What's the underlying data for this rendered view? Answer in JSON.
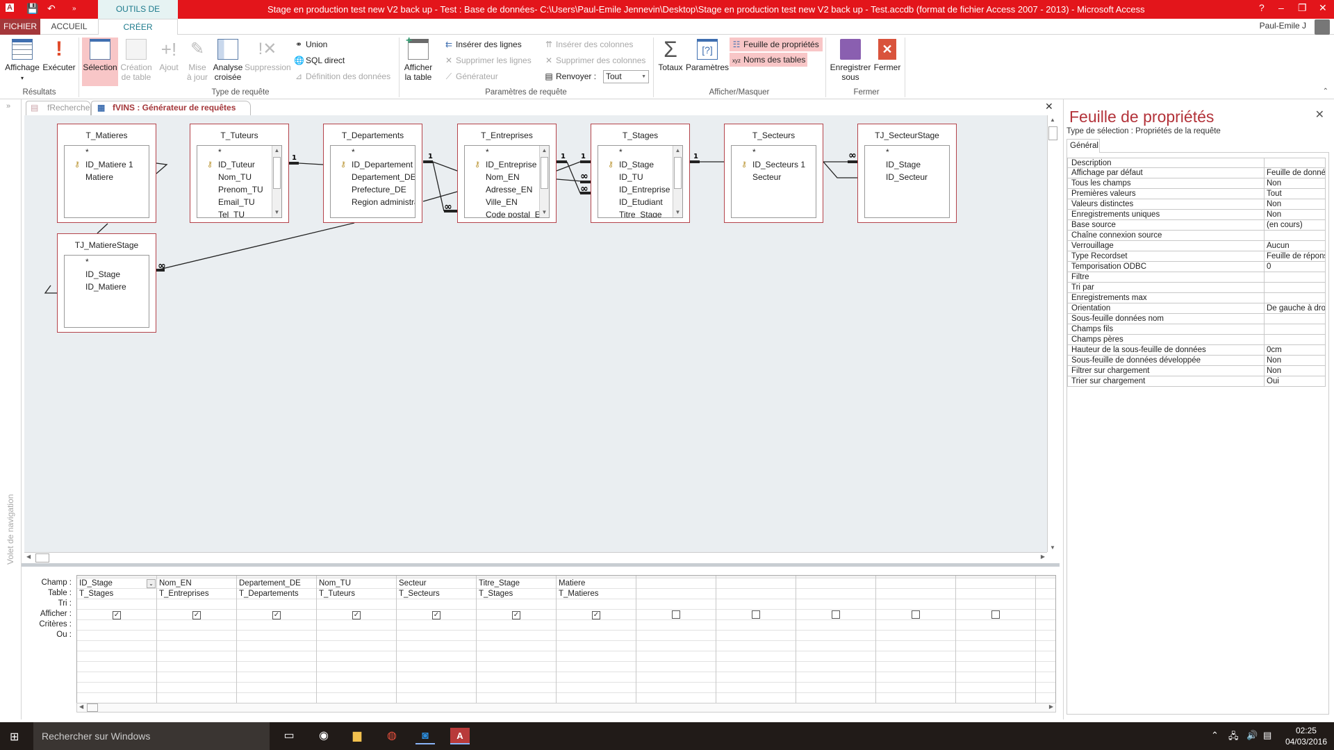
{
  "window": {
    "title": "Stage en production test new V2 back up - Test : Base de données- C:\\Users\\Paul-Emile Jennevin\\Desktop\\Stage en production test new V2 back up - Test.accdb (format de fichier Access 2007 - 2013) -  Microsoft Access",
    "context_tab": "OUTILS DE REQUÊTE",
    "user": "Paul-Emile J",
    "help": "?",
    "brand_color": "#e3151b"
  },
  "ribbon": {
    "tabs": [
      "FICHIER",
      "ACCUEIL",
      "CRÉER"
    ],
    "resultats": {
      "label": "Résultats",
      "affichage": "Affichage",
      "executer": "Exécuter"
    },
    "type_requete": {
      "label": "Type de requête",
      "selection": "Sélection",
      "creation": "Création",
      "creation2": "de table",
      "ajout": "Ajout",
      "mise": "Mise",
      "mise2": "à jour",
      "analyse": "Analyse",
      "analyse2": "croisée",
      "suppression": "Suppression",
      "union": "Union",
      "sql": "SQL direct",
      "definition": "Définition des données"
    },
    "parametres": {
      "label": "Paramètres de requête",
      "afficher": "Afficher",
      "afficher2": "la table",
      "inserer_lignes": "Insérer des lignes",
      "supprimer_lignes": "Supprimer les lignes",
      "generateur": "Générateur",
      "inserer_colonnes": "Insérer des colonnes",
      "supprimer_colonnes": "Supprimer des colonnes",
      "renvoyer": "Renvoyer :",
      "renvoyer_value": "Tout"
    },
    "afficher_masquer": {
      "label": "Afficher/Masquer",
      "totaux": "Totaux",
      "parametres": "Paramètres",
      "feuille": "Feuille de propriétés",
      "noms": "Noms des tables"
    },
    "fermer": {
      "label": "Fermer",
      "enregistrer": "Enregistrer",
      "enregistrer2": "sous",
      "fermer": "Fermer"
    }
  },
  "doc_tabs": [
    {
      "label": "fRecherche",
      "active": false
    },
    {
      "label": "fVINS : Générateur de requêtes",
      "active": true
    }
  ],
  "nav_pane": "Volet de navigation",
  "tables": [
    {
      "name": "T_Matieres",
      "fields": [
        "*",
        "ID_Matiere 1",
        "Matiere"
      ],
      "key": 1,
      "scroll": false
    },
    {
      "name": "T_Tuteurs",
      "fields": [
        "*",
        "ID_Tuteur",
        "Nom_TU",
        "Prenom_TU",
        "Email_TU",
        "Tel_TU"
      ],
      "key": 1,
      "scroll": true
    },
    {
      "name": "T_Departements",
      "fields": [
        "*",
        "ID_Departement",
        "Departement_DE",
        "Prefecture_DE",
        "Region administrat"
      ],
      "key": 1,
      "scroll": false
    },
    {
      "name": "T_Entreprises",
      "fields": [
        "*",
        "ID_Entreprise",
        "Nom_EN",
        "Adresse_EN",
        "Ville_EN",
        "Code postal_EN"
      ],
      "key": 1,
      "scroll": true
    },
    {
      "name": "T_Stages",
      "fields": [
        "*",
        "ID_Stage",
        "ID_TU",
        "ID_Entreprise",
        "ID_Etudiant",
        "Titre_Stage"
      ],
      "key": 1,
      "scroll": true
    },
    {
      "name": "T_Secteurs",
      "fields": [
        "*",
        "ID_Secteurs 1",
        "Secteur"
      ],
      "key": 1,
      "scroll": false
    },
    {
      "name": "TJ_SecteurStage",
      "fields": [
        "*",
        "ID_Stage",
        "ID_Secteur"
      ],
      "key": -1,
      "scroll": false
    },
    {
      "name": "TJ_MatiereStage",
      "fields": [
        "*",
        "ID_Stage",
        "ID_Matiere"
      ],
      "key": -1,
      "scroll": false
    }
  ],
  "relationship_labels": {
    "one": "1",
    "many": "∞"
  },
  "grid": {
    "row_labels": [
      "Champ :",
      "Table :",
      "Tri :",
      "Afficher :",
      "Critères :",
      "Ou :"
    ],
    "columns": [
      {
        "champ": "ID_Stage",
        "table": "T_Stages",
        "afficher": true
      },
      {
        "champ": "Nom_EN",
        "table": "T_Entreprises",
        "afficher": true
      },
      {
        "champ": "Departement_DE",
        "table": "T_Departements",
        "afficher": true
      },
      {
        "champ": "Nom_TU",
        "table": "T_Tuteurs",
        "afficher": true
      },
      {
        "champ": "Secteur",
        "table": "T_Secteurs",
        "afficher": true
      },
      {
        "champ": "Titre_Stage",
        "table": "T_Stages",
        "afficher": true
      },
      {
        "champ": "Matiere",
        "table": "T_Matieres",
        "afficher": true
      },
      {
        "champ": "",
        "table": "",
        "afficher": false
      },
      {
        "champ": "",
        "table": "",
        "afficher": false
      },
      {
        "champ": "",
        "table": "",
        "afficher": false
      },
      {
        "champ": "",
        "table": "",
        "afficher": false
      },
      {
        "champ": "",
        "table": "",
        "afficher": false
      },
      {
        "champ": "",
        "table": "",
        "afficher": false
      }
    ]
  },
  "properties": {
    "title": "Feuille de propriétés",
    "selection_type": "Type de sélection :  Propriétés de la requête",
    "tab": "Général",
    "rows": [
      [
        "Description",
        ""
      ],
      [
        "Affichage par défaut",
        "Feuille de données"
      ],
      [
        "Tous les champs",
        "Non"
      ],
      [
        "Premières valeurs",
        "Tout"
      ],
      [
        "Valeurs distinctes",
        "Non"
      ],
      [
        "Enregistrements uniques",
        "Non"
      ],
      [
        "Base source",
        "(en cours)"
      ],
      [
        "Chaîne connexion source",
        ""
      ],
      [
        "Verrouillage",
        "Aucun"
      ],
      [
        "Type Recordset",
        "Feuille de réponse dynamique"
      ],
      [
        "Temporisation ODBC",
        "0"
      ],
      [
        "Filtre",
        ""
      ],
      [
        "Tri par",
        ""
      ],
      [
        "Enregistrements max",
        ""
      ],
      [
        "Orientation",
        "De gauche à droite"
      ],
      [
        "Sous-feuille données nom",
        ""
      ],
      [
        "Champs fils",
        ""
      ],
      [
        "Champs pères",
        ""
      ],
      [
        "Hauteur de la sous-feuille de données",
        "0cm"
      ],
      [
        "Sous-feuille de données développée",
        "Non"
      ],
      [
        "Filtrer sur chargement",
        "Non"
      ],
      [
        "Trier sur chargement",
        "Oui"
      ]
    ]
  },
  "taskbar": {
    "search": "Rechercher sur Windows",
    "time": "02:25",
    "date": "04/03/2016"
  }
}
